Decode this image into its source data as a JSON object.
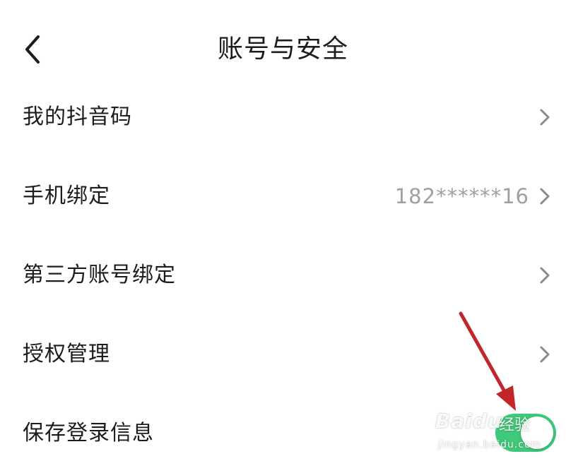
{
  "header": {
    "title": "账号与安全"
  },
  "menu": {
    "items": [
      {
        "label": "我的抖音码",
        "value": ""
      },
      {
        "label": "手机绑定",
        "value": "182******16"
      },
      {
        "label": "第三方账号绑定",
        "value": ""
      },
      {
        "label": "授权管理",
        "value": ""
      },
      {
        "label": "保存登录信息",
        "toggle_on": true
      }
    ]
  },
  "watermark": {
    "brand": "Baidu",
    "sub": "经验",
    "url": "jingyan.baidu.com"
  },
  "colors": {
    "toggle_on": "#3fc97a",
    "annotation_arrow": "#c0262a",
    "secondary_text": "#a0a0a0"
  },
  "icons": {
    "back": "chevron-left-icon",
    "row": "chevron-right-icon",
    "annotation": "red-arrow-icon"
  }
}
